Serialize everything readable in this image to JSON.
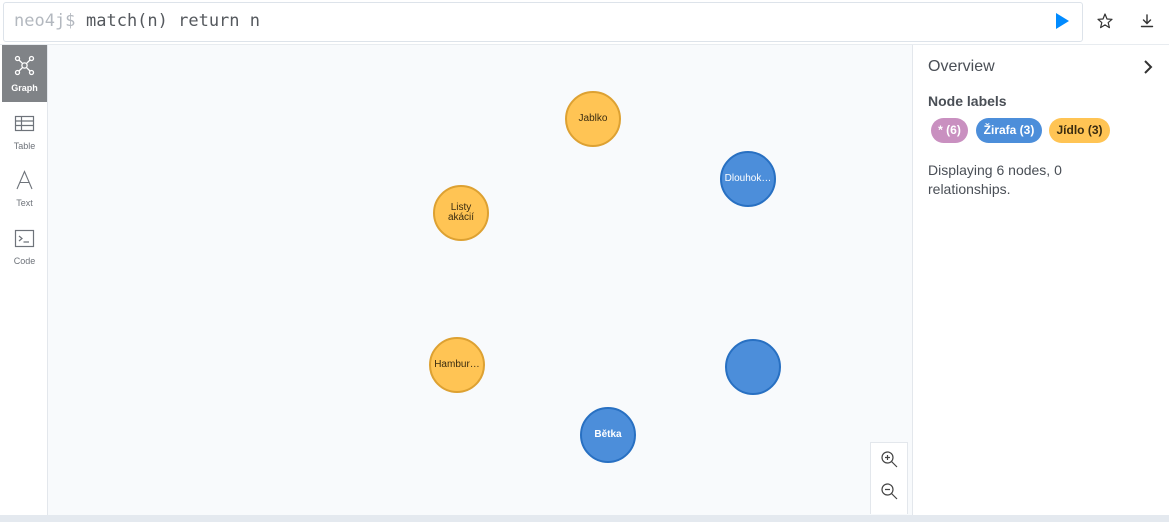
{
  "editor": {
    "prompt": "neo4j$",
    "query": "match(n) return n"
  },
  "sidebar": {
    "items": [
      {
        "label": "Graph",
        "icon": "graph-icon",
        "active": true
      },
      {
        "label": "Table",
        "icon": "table-icon",
        "active": false
      },
      {
        "label": "Text",
        "icon": "text-icon",
        "active": false
      },
      {
        "label": "Code",
        "icon": "code-icon",
        "active": false
      }
    ]
  },
  "graph": {
    "nodes": [
      {
        "caption": "Jablko",
        "label": "Jídlo"
      },
      {
        "caption": "Dlouhok…",
        "label": "Žirafa"
      },
      {
        "caption": "Listy akácií",
        "label": "Jídlo"
      },
      {
        "caption": "Hambur…",
        "label": "Jídlo"
      },
      {
        "caption": "",
        "label": "Žirafa"
      },
      {
        "caption": "Bětka",
        "label": "Žirafa"
      }
    ]
  },
  "overview": {
    "title": "Overview",
    "node_labels_heading": "Node labels",
    "pills": [
      {
        "text": "* (6)",
        "color": "#c990c0"
      },
      {
        "text": "Žirafa (3)",
        "color": "#4c8eda"
      },
      {
        "text": "Jídlo (3)",
        "color": "#ffc454"
      }
    ],
    "status": "Displaying 6 nodes, 0 relationships."
  },
  "colors": {
    "food": "#ffc454",
    "giraffe": "#4c8eda",
    "all": "#c990c0",
    "run": "#018bff"
  }
}
